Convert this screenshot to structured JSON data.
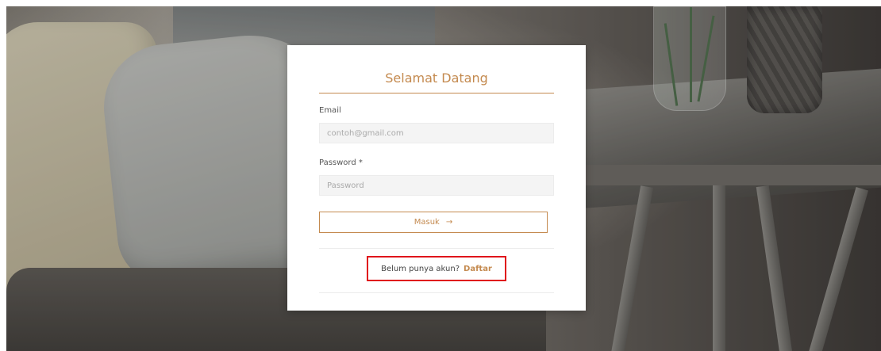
{
  "login": {
    "title": "Selamat Datang",
    "email_label": "Email",
    "email_placeholder": "contoh@gmail.com",
    "password_label": "Password *",
    "password_placeholder": "Password",
    "submit_label": "Masuk",
    "submit_icon": "→",
    "register_prompt": "Belum punya akun?",
    "register_link": "Daftar"
  },
  "colors": {
    "accent": "#c48a4f",
    "highlight_border": "#e0141b"
  }
}
